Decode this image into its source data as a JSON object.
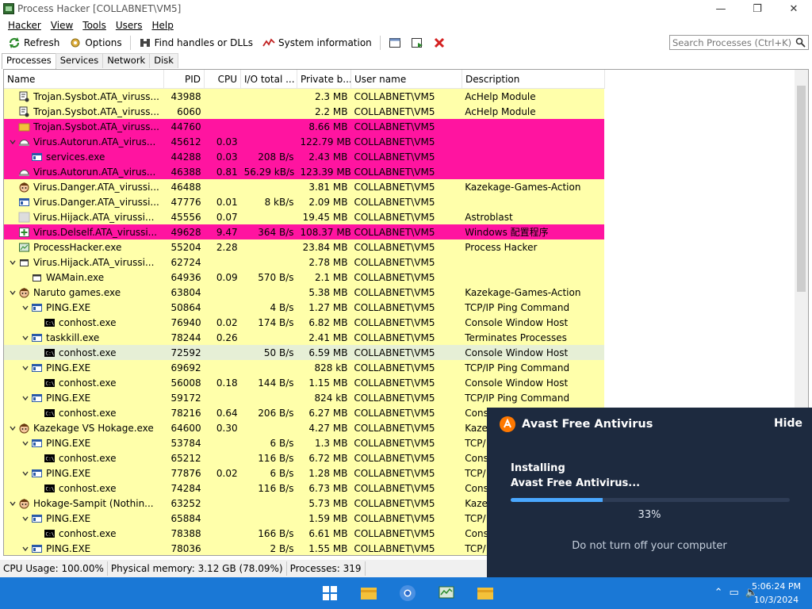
{
  "window": {
    "title": "Process Hacker [COLLABNET\\VM5]",
    "controls": {
      "minimize": "—",
      "maximize": "❐",
      "close": "✕"
    }
  },
  "menu": [
    "Hacker",
    "View",
    "Tools",
    "Users",
    "Help"
  ],
  "toolbar": {
    "refresh": "Refresh",
    "options": "Options",
    "find_handles": "Find handles or DLLs",
    "system_info": "System information",
    "search_placeholder": "Search Processes (Ctrl+K)"
  },
  "tabs": [
    "Processes",
    "Services",
    "Network",
    "Disk"
  ],
  "columns": [
    "Name",
    "PID",
    "CPU",
    "I/O total ...",
    "Private b...",
    "User name",
    "Description"
  ],
  "rows": [
    {
      "name": "Trojan.Sysbot.ATA_viruss...",
      "pid": "43988",
      "cpu": "",
      "io": "",
      "priv": "2.3 MB",
      "user": "COLLABNET\\VM5",
      "desc": "AcHelp Module",
      "bg": "yellow",
      "indent": 0,
      "chev": "",
      "icon": "trojan-icon"
    },
    {
      "name": "Trojan.Sysbot.ATA_viruss...",
      "pid": "6060",
      "cpu": "",
      "io": "",
      "priv": "2.2 MB",
      "user": "COLLABNET\\VM5",
      "desc": "AcHelp Module",
      "bg": "yellow",
      "indent": 0,
      "chev": "",
      "icon": "trojan-icon"
    },
    {
      "name": "Trojan.Sysbot.ATA_viruss...",
      "pid": "44760",
      "cpu": "",
      "io": "",
      "priv": "8.66 MB",
      "user": "COLLABNET\\VM5",
      "desc": "",
      "bg": "pink",
      "indent": 0,
      "chev": "",
      "icon": "folder-icon"
    },
    {
      "name": "Virus.Autorun.ATA_virus...",
      "pid": "45612",
      "cpu": "0.03",
      "io": "",
      "priv": "122.79 MB",
      "user": "COLLABNET\\VM5",
      "desc": "",
      "bg": "pink",
      "indent": 0,
      "chev": "v",
      "icon": "drive-icon"
    },
    {
      "name": "services.exe",
      "pid": "44288",
      "cpu": "0.03",
      "io": "208 B/s",
      "priv": "2.43 MB",
      "user": "COLLABNET\\VM5",
      "desc": "",
      "bg": "pink",
      "indent": 1,
      "chev": "",
      "icon": "window-icon"
    },
    {
      "name": "Virus.Autorun.ATA_virus...",
      "pid": "46388",
      "cpu": "0.81",
      "io": "56.29 kB/s",
      "priv": "123.39 MB",
      "user": "COLLABNET\\VM5",
      "desc": "",
      "bg": "pink",
      "indent": 0,
      "chev": "",
      "icon": "drive-icon"
    },
    {
      "name": "Virus.Danger.ATA_virussi...",
      "pid": "46488",
      "cpu": "",
      "io": "",
      "priv": "3.81 MB",
      "user": "COLLABNET\\VM5",
      "desc": "Kazekage-Games-Action",
      "bg": "yellow",
      "indent": 0,
      "chev": "",
      "icon": "face-icon"
    },
    {
      "name": "Virus.Danger.ATA_virussi...",
      "pid": "47776",
      "cpu": "0.01",
      "io": "8 kB/s",
      "priv": "2.09 MB",
      "user": "COLLABNET\\VM5",
      "desc": "",
      "bg": "yellow",
      "indent": 0,
      "chev": "",
      "icon": "window-icon"
    },
    {
      "name": "Virus.Hijack.ATA_virussi...",
      "pid": "45556",
      "cpu": "0.07",
      "io": "",
      "priv": "19.45 MB",
      "user": "COLLABNET\\VM5",
      "desc": "Astroblast",
      "bg": "yellow",
      "indent": 0,
      "chev": "",
      "icon": "blank-icon"
    },
    {
      "name": "Virus.Delself.ATA_virussi...",
      "pid": "49628",
      "cpu": "9.47",
      "io": "364 B/s",
      "priv": "108.37 MB",
      "user": "COLLABNET\\VM5",
      "desc": "Windows 配置程序",
      "bg": "pink",
      "indent": 0,
      "chev": "",
      "icon": "installer-icon"
    },
    {
      "name": "ProcessHacker.exe",
      "pid": "55204",
      "cpu": "2.28",
      "io": "",
      "priv": "23.84 MB",
      "user": "COLLABNET\\VM5",
      "desc": "Process Hacker",
      "bg": "yellow",
      "indent": 0,
      "chev": "",
      "icon": "processhacker-icon"
    },
    {
      "name": "Virus.Hijack.ATA_virussi...",
      "pid": "62724",
      "cpu": "",
      "io": "",
      "priv": "2.78 MB",
      "user": "COLLABNET\\VM5",
      "desc": "",
      "bg": "yellow",
      "indent": 0,
      "chev": "v",
      "icon": "app-outline-icon"
    },
    {
      "name": "WAMain.exe",
      "pid": "64936",
      "cpu": "0.09",
      "io": "570 B/s",
      "priv": "2.1 MB",
      "user": "COLLABNET\\VM5",
      "desc": "",
      "bg": "yellow",
      "indent": 1,
      "chev": "",
      "icon": "app-outline-icon"
    },
    {
      "name": "Naruto games.exe",
      "pid": "63804",
      "cpu": "",
      "io": "",
      "priv": "5.38 MB",
      "user": "COLLABNET\\VM5",
      "desc": "Kazekage-Games-Action",
      "bg": "yellow",
      "indent": 0,
      "chev": "v",
      "icon": "face-icon"
    },
    {
      "name": "PING.EXE",
      "pid": "50864",
      "cpu": "",
      "io": "4 B/s",
      "priv": "1.27 MB",
      "user": "COLLABNET\\VM5",
      "desc": "TCP/IP Ping Command",
      "bg": "yellow",
      "indent": 1,
      "chev": "v",
      "icon": "window-icon"
    },
    {
      "name": "conhost.exe",
      "pid": "76940",
      "cpu": "0.02",
      "io": "174 B/s",
      "priv": "6.82 MB",
      "user": "COLLABNET\\VM5",
      "desc": "Console Window Host",
      "bg": "yellow",
      "indent": 2,
      "chev": "",
      "icon": "console-icon"
    },
    {
      "name": "taskkill.exe",
      "pid": "78244",
      "cpu": "0.26",
      "io": "",
      "priv": "2.41 MB",
      "user": "COLLABNET\\VM5",
      "desc": "Terminates Processes",
      "bg": "yellow",
      "indent": 1,
      "chev": "v",
      "icon": "window-icon"
    },
    {
      "name": "conhost.exe",
      "pid": "72592",
      "cpu": "",
      "io": "50 B/s",
      "priv": "6.59 MB",
      "user": "COLLABNET\\VM5",
      "desc": "Console Window Host",
      "bg": "sel",
      "indent": 2,
      "chev": "",
      "icon": "console-icon"
    },
    {
      "name": "PING.EXE",
      "pid": "69692",
      "cpu": "",
      "io": "",
      "priv": "828 kB",
      "user": "COLLABNET\\VM5",
      "desc": "TCP/IP Ping Command",
      "bg": "yellow",
      "indent": 1,
      "chev": "v",
      "icon": "window-icon"
    },
    {
      "name": "conhost.exe",
      "pid": "56008",
      "cpu": "0.18",
      "io": "144 B/s",
      "priv": "1.15 MB",
      "user": "COLLABNET\\VM5",
      "desc": "Console Window Host",
      "bg": "yellow",
      "indent": 2,
      "chev": "",
      "icon": "console-icon"
    },
    {
      "name": "PING.EXE",
      "pid": "59172",
      "cpu": "",
      "io": "",
      "priv": "824 kB",
      "user": "COLLABNET\\VM5",
      "desc": "TCP/IP Ping Command",
      "bg": "yellow",
      "indent": 1,
      "chev": "v",
      "icon": "window-icon"
    },
    {
      "name": "conhost.exe",
      "pid": "78216",
      "cpu": "0.64",
      "io": "206 B/s",
      "priv": "6.27 MB",
      "user": "COLLABNET\\VM5",
      "desc": "Cons",
      "bg": "yellow",
      "indent": 2,
      "chev": "",
      "icon": "console-icon"
    },
    {
      "name": "Kazekage VS Hokage.exe",
      "pid": "64600",
      "cpu": "0.30",
      "io": "",
      "priv": "4.27 MB",
      "user": "COLLABNET\\VM5",
      "desc": "Kazek",
      "bg": "yellow",
      "indent": 0,
      "chev": "v",
      "icon": "face-icon"
    },
    {
      "name": "PING.EXE",
      "pid": "53784",
      "cpu": "",
      "io": "6 B/s",
      "priv": "1.3 MB",
      "user": "COLLABNET\\VM5",
      "desc": "TCP/",
      "bg": "yellow",
      "indent": 1,
      "chev": "v",
      "icon": "window-icon"
    },
    {
      "name": "conhost.exe",
      "pid": "65212",
      "cpu": "",
      "io": "116 B/s",
      "priv": "6.72 MB",
      "user": "COLLABNET\\VM5",
      "desc": "Cons",
      "bg": "yellow",
      "indent": 2,
      "chev": "",
      "icon": "console-icon"
    },
    {
      "name": "PING.EXE",
      "pid": "77876",
      "cpu": "0.02",
      "io": "6 B/s",
      "priv": "1.28 MB",
      "user": "COLLABNET\\VM5",
      "desc": "TCP/",
      "bg": "yellow",
      "indent": 1,
      "chev": "v",
      "icon": "window-icon"
    },
    {
      "name": "conhost.exe",
      "pid": "74284",
      "cpu": "",
      "io": "116 B/s",
      "priv": "6.73 MB",
      "user": "COLLABNET\\VM5",
      "desc": "Cons",
      "bg": "yellow",
      "indent": 2,
      "chev": "",
      "icon": "console-icon"
    },
    {
      "name": "Hokage-Sampit (Nothin...",
      "pid": "63252",
      "cpu": "",
      "io": "",
      "priv": "5.73 MB",
      "user": "COLLABNET\\VM5",
      "desc": "Kazek",
      "bg": "yellow",
      "indent": 0,
      "chev": "v",
      "icon": "face-icon"
    },
    {
      "name": "PING.EXE",
      "pid": "65884",
      "cpu": "",
      "io": "",
      "priv": "1.59 MB",
      "user": "COLLABNET\\VM5",
      "desc": "TCP/",
      "bg": "yellow",
      "indent": 1,
      "chev": "v",
      "icon": "window-icon"
    },
    {
      "name": "conhost.exe",
      "pid": "78388",
      "cpu": "",
      "io": "166 B/s",
      "priv": "6.61 MB",
      "user": "COLLABNET\\VM5",
      "desc": "Cons",
      "bg": "yellow",
      "indent": 2,
      "chev": "",
      "icon": "console-icon"
    },
    {
      "name": "PING.EXE",
      "pid": "78036",
      "cpu": "",
      "io": "2 B/s",
      "priv": "1.55 MB",
      "user": "COLLABNET\\VM5",
      "desc": "TCP/",
      "bg": "yellow",
      "indent": 1,
      "chev": "v",
      "icon": "window-icon"
    }
  ],
  "status": {
    "cpu": "CPU Usage: 100.00%",
    "memory": "Physical memory: 3.12 GB (78.09%)",
    "processes": "Processes: 319"
  },
  "avast": {
    "title": "Avast Free Antivirus",
    "hide": "Hide",
    "status_line1": "Installing",
    "status_line2": "Avast Free Antivirus...",
    "progress": 0.33,
    "percent_text": "33%",
    "note": "Do not turn off your computer",
    "bg_color": "#1d2a3f",
    "accent_color": "#ff7800"
  },
  "taskbar": {
    "time": "5:06:24 PM",
    "date": "10/3/2024",
    "bg_color": "#1a78d6"
  },
  "colors": {
    "row_yellow": "#ffffaa",
    "row_pink": "#ff14a0",
    "row_selected": "#e6efd6"
  }
}
